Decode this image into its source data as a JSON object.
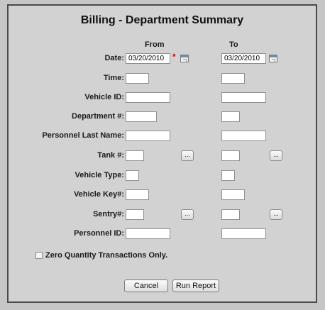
{
  "title": "Billing - Department Summary",
  "columns": {
    "from": "From",
    "to": "To"
  },
  "fields": {
    "date": {
      "label": "Date:",
      "from_value": "03/20/2010",
      "to_value": "03/20/2010",
      "required_mark": "*"
    },
    "time": {
      "label": "Time:",
      "from_value": "",
      "to_value": ""
    },
    "vehicle_id": {
      "label": "Vehicle ID:",
      "from_value": "",
      "to_value": ""
    },
    "department": {
      "label": "Department #:",
      "from_value": "",
      "to_value": ""
    },
    "personnel_last_name": {
      "label": "Personnel Last Name:",
      "from_value": "",
      "to_value": ""
    },
    "tank": {
      "label": "Tank #:",
      "from_value": "",
      "to_value": "",
      "lookup_label": "..."
    },
    "vehicle_type": {
      "label": "Vehicle Type:",
      "from_value": "",
      "to_value": ""
    },
    "vehicle_key": {
      "label": "Vehicle Key#:",
      "from_value": "",
      "to_value": ""
    },
    "sentry": {
      "label": "Sentry#:",
      "from_value": "",
      "to_value": "",
      "lookup_label": "..."
    },
    "personnel_id": {
      "label": "Personnel ID:",
      "from_value": "",
      "to_value": ""
    }
  },
  "zero_quantity": {
    "label": "Zero Quantity Transactions Only.",
    "checked": false
  },
  "buttons": {
    "cancel": "Cancel",
    "run_report": "Run Report"
  },
  "icons": {
    "calendar": "calendar-icon"
  },
  "colors": {
    "background": "#c6c6c6",
    "required": "#d60000"
  }
}
